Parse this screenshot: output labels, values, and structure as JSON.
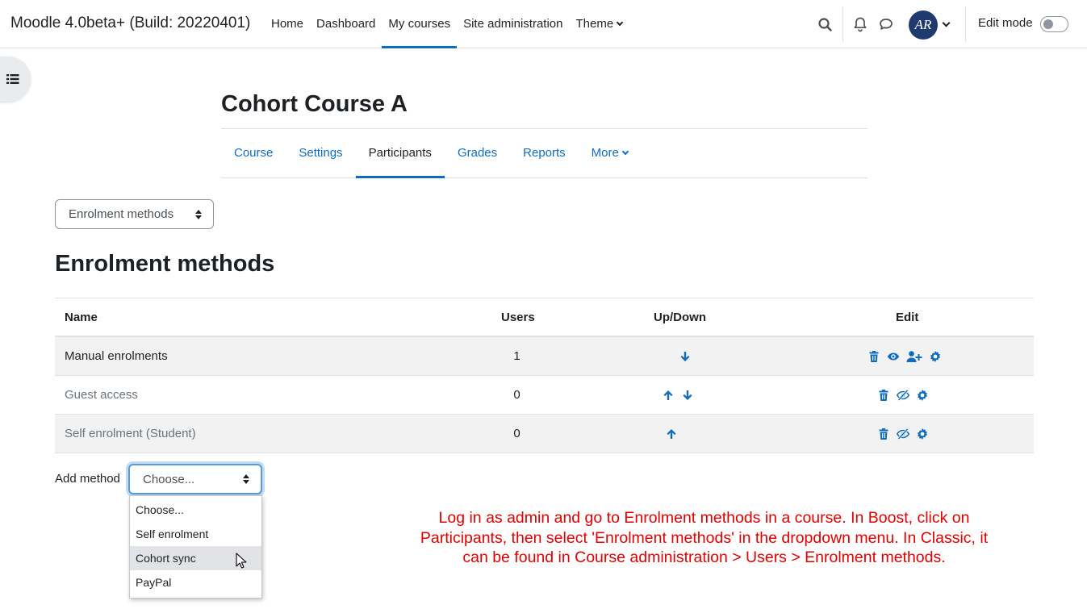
{
  "navbar": {
    "brand": "Moodle 4.0beta+ (Build: 20220401)",
    "links": [
      {
        "label": "Home",
        "active": false
      },
      {
        "label": "Dashboard",
        "active": false
      },
      {
        "label": "My courses",
        "active": true
      },
      {
        "label": "Site administration",
        "active": false
      },
      {
        "label": "Theme",
        "active": false,
        "has_caret": true
      }
    ],
    "icons": [
      "search-icon",
      "bell-icon",
      "chat-icon"
    ],
    "avatar_initials": "AR",
    "edit_mode_label": "Edit mode",
    "edit_mode_on": false
  },
  "course": {
    "title": "Cohort Course A",
    "tabs": [
      {
        "label": "Course",
        "active": false
      },
      {
        "label": "Settings",
        "active": false
      },
      {
        "label": "Participants",
        "active": true
      },
      {
        "label": "Grades",
        "active": false
      },
      {
        "label": "Reports",
        "active": false
      },
      {
        "label": "More",
        "active": false,
        "has_caret": true
      }
    ]
  },
  "page_select": {
    "value": "Enrolment methods"
  },
  "section_title": "Enrolment methods",
  "table": {
    "headers": {
      "name": "Name",
      "users": "Users",
      "updown": "Up/Down",
      "edit": "Edit"
    },
    "rows": [
      {
        "name": "Manual enrolments",
        "users": "1",
        "updown": [
          "down"
        ],
        "edit": [
          "trash-icon",
          "eye-icon",
          "enrol-users-icon",
          "gear-icon"
        ],
        "enabled": true
      },
      {
        "name": "Guest access",
        "users": "0",
        "updown": [
          "up",
          "down"
        ],
        "edit": [
          "trash-icon",
          "eye-slash-icon",
          "gear-icon"
        ],
        "enabled": false
      },
      {
        "name": "Self enrolment (Student)",
        "users": "0",
        "updown": [
          "up"
        ],
        "edit": [
          "trash-icon",
          "eye-slash-icon",
          "gear-icon"
        ],
        "enabled": false
      }
    ]
  },
  "add_method": {
    "label": "Add method",
    "selected": "Choose...",
    "options": [
      "Choose...",
      "Self enrolment",
      "Cohort sync",
      "PayPal"
    ],
    "hovered_option": "Cohort sync"
  },
  "annotation": "Log in as admin and go to Enrolment methods in a course. In Boost, click on Participants, then select 'Enrolment methods' in the dropdown menu. In Classic, it can be found in Course administration > Users > Enrolment methods.",
  "colors": {
    "accent": "#0f6cbf",
    "annotation": "#e20000",
    "text": "#1d2125"
  }
}
